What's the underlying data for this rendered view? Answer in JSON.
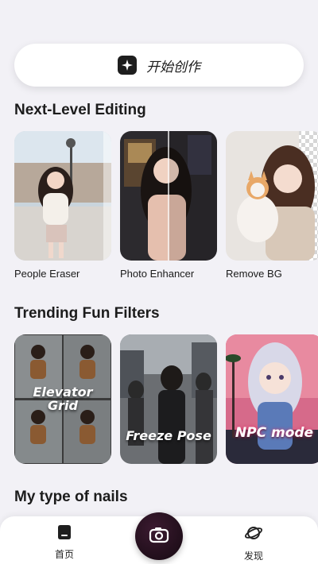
{
  "create": {
    "label": "开始创作",
    "icon": "sparkle-icon"
  },
  "sections": {
    "editing": {
      "title": "Next-Level Editing",
      "cards": [
        {
          "label": "People Eraser"
        },
        {
          "label": "Photo Enhancer"
        },
        {
          "label": "Remove BG"
        }
      ]
    },
    "filters": {
      "title": "Trending Fun Filters",
      "cards": [
        {
          "overlay": "Elevator Grid"
        },
        {
          "overlay": "Freeze Pose"
        },
        {
          "overlay": "NPC mode"
        }
      ]
    },
    "nails": {
      "title": "My type of nails"
    }
  },
  "tabbar": {
    "home": {
      "label": "首页",
      "icon": "home-icon"
    },
    "camera": {
      "icon": "camera-icon"
    },
    "discover": {
      "label": "发现",
      "icon": "planet-icon"
    }
  }
}
